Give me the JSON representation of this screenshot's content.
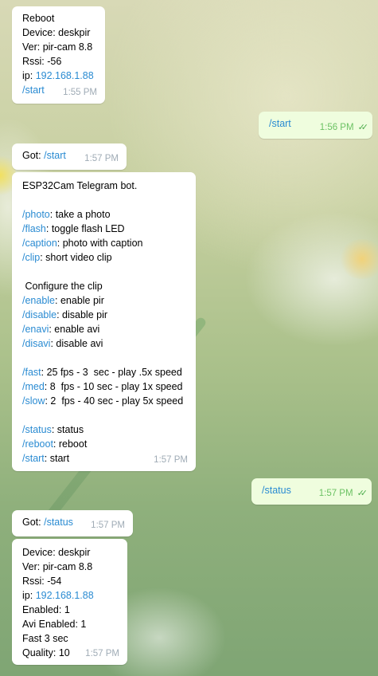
{
  "messages": {
    "m1": {
      "lines": [
        "Reboot",
        "Device: deskpir",
        "Ver: pir-cam 8.8",
        "Rssi: -56"
      ],
      "ip_prefix": "ip: ",
      "ip": "192.168.1.88",
      "cmd": "/start",
      "time": "1:55 PM"
    },
    "m2": {
      "cmd": "/start",
      "time": "1:56 PM",
      "ticks": "✓✓"
    },
    "m3": {
      "prefix": "Got: ",
      "cmd": "/start",
      "time": "1:57 PM"
    },
    "m4": {
      "title": "ESP32Cam Telegram bot.",
      "photo_cmd": "/photo",
      "photo_desc": ": take a photo",
      "flash_cmd": "/flash",
      "flash_desc": ": toggle flash LED",
      "caption_cmd": "/caption",
      "caption_desc": ": photo with caption",
      "clip_cmd": "/clip",
      "clip_desc": ": short video clip",
      "configure": " Configure the clip",
      "enable_cmd": "/enable",
      "enable_desc": ": enable pir",
      "disable_cmd": "/disable",
      "disable_desc": ": disable pir",
      "enavi_cmd": "/enavi",
      "enavi_desc": ": enable avi",
      "disavi_cmd": "/disavi",
      "disavi_desc": ": disable avi",
      "fast_cmd": "/fast",
      "fast_desc": ": 25 fps - 3  sec - play .5x speed",
      "med_cmd": "/med",
      "med_desc": ": 8  fps - 10 sec - play 1x speed",
      "slow_cmd": "/slow",
      "slow_desc": ": 2  fps - 40 sec - play 5x speed",
      "status_cmd": "/status",
      "status_desc": ": status",
      "reboot_cmd": "/reboot",
      "reboot_desc": ": reboot",
      "start_cmd": "/start",
      "start_desc": ": start",
      "time": "1:57 PM"
    },
    "m5": {
      "cmd": "/status",
      "time": "1:57 PM",
      "ticks": "✓✓"
    },
    "m6": {
      "prefix": "Got: ",
      "cmd": "/status",
      "time": "1:57 PM"
    },
    "m7": {
      "device": "Device: deskpir",
      "ver": "Ver: pir-cam 8.8",
      "rssi": "Rssi: -54",
      "ip_prefix": "ip: ",
      "ip": "192.168.1.88",
      "enabled": "Enabled: 1",
      "avi": "Avi Enabled: 1",
      "fast": "Fast 3 sec",
      "quality": "Quality: 10",
      "time": "1:57 PM"
    }
  }
}
